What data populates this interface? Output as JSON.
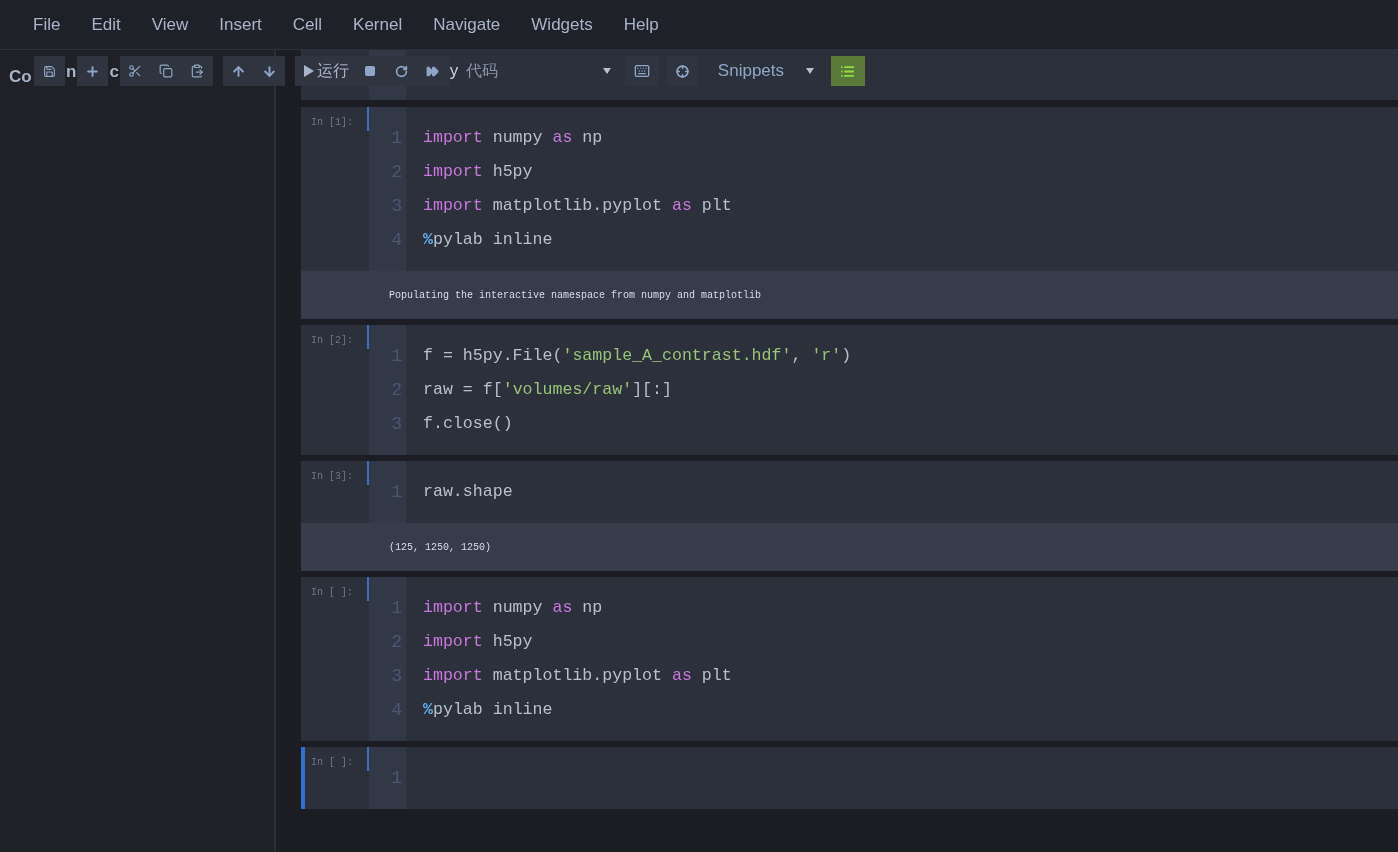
{
  "menu": [
    "File",
    "Edit",
    "View",
    "Insert",
    "Cell",
    "Kernel",
    "Navigate",
    "Widgets",
    "Help"
  ],
  "sidebar": {
    "title_fragments": [
      "Co",
      "n",
      "c"
    ]
  },
  "toolbar": {
    "run_label": "运行",
    "hidden_fragment": "y",
    "cell_type": "代码",
    "snippets": "Snippets",
    "toc_active": true
  },
  "cells": [
    {
      "prompt": "In [1]:",
      "selected": false,
      "lines": [
        {
          "number": "1",
          "tokens": [
            {
              "text": "import",
              "kind": "keyword"
            },
            {
              "text": " numpy ",
              "kind": "plain"
            },
            {
              "text": "as",
              "kind": "keyword"
            },
            {
              "text": " np",
              "kind": "plain"
            }
          ]
        },
        {
          "number": "2",
          "tokens": [
            {
              "text": "import",
              "kind": "keyword"
            },
            {
              "text": " h5py",
              "kind": "plain"
            }
          ]
        },
        {
          "number": "3",
          "tokens": [
            {
              "text": "import",
              "kind": "keyword"
            },
            {
              "text": " matplotlib.pyplot ",
              "kind": "plain"
            },
            {
              "text": "as",
              "kind": "keyword"
            },
            {
              "text": " plt",
              "kind": "plain"
            }
          ]
        },
        {
          "number": "4",
          "tokens": [
            {
              "text": "%",
              "kind": "magic"
            },
            {
              "text": "pylab inline",
              "kind": "plain"
            }
          ]
        }
      ],
      "output": "Populating the interactive namespace from numpy and matplotlib"
    },
    {
      "prompt": "In [2]:",
      "selected": false,
      "lines": [
        {
          "number": "1",
          "tokens": [
            {
              "text": "f = h5py.File(",
              "kind": "plain"
            },
            {
              "text": "'sample_A_contrast.hdf'",
              "kind": "string"
            },
            {
              "text": ", ",
              "kind": "plain"
            },
            {
              "text": "'r'",
              "kind": "string"
            },
            {
              "text": ")",
              "kind": "plain"
            }
          ]
        },
        {
          "number": "2",
          "tokens": [
            {
              "text": "raw = f[",
              "kind": "plain"
            },
            {
              "text": "'volumes/raw'",
              "kind": "string"
            },
            {
              "text": "][:]",
              "kind": "plain"
            }
          ]
        },
        {
          "number": "3",
          "tokens": [
            {
              "text": "f.close()",
              "kind": "plain"
            }
          ]
        }
      ]
    },
    {
      "prompt": "In [3]:",
      "selected": false,
      "lines": [
        {
          "number": "1",
          "tokens": [
            {
              "text": "raw.shape",
              "kind": "plain"
            }
          ]
        }
      ],
      "output": "(125, 1250, 1250)"
    },
    {
      "prompt": "In [ ]:",
      "selected": false,
      "lines": [
        {
          "number": "1",
          "tokens": [
            {
              "text": "import",
              "kind": "keyword"
            },
            {
              "text": " numpy ",
              "kind": "plain"
            },
            {
              "text": "as",
              "kind": "keyword"
            },
            {
              "text": " np",
              "kind": "plain"
            }
          ]
        },
        {
          "number": "2",
          "tokens": [
            {
              "text": "import",
              "kind": "keyword"
            },
            {
              "text": " h5py",
              "kind": "plain"
            }
          ]
        },
        {
          "number": "3",
          "tokens": [
            {
              "text": "import",
              "kind": "keyword"
            },
            {
              "text": " matplotlib.pyplot ",
              "kind": "plain"
            },
            {
              "text": "as",
              "kind": "keyword"
            },
            {
              "text": " plt",
              "kind": "plain"
            }
          ]
        },
        {
          "number": "4",
          "tokens": [
            {
              "text": "%",
              "kind": "magic"
            },
            {
              "text": "pylab inline",
              "kind": "plain"
            }
          ]
        }
      ]
    },
    {
      "prompt": "In [ ]:",
      "selected": true,
      "lines": [
        {
          "number": "1"
        }
      ]
    }
  ]
}
